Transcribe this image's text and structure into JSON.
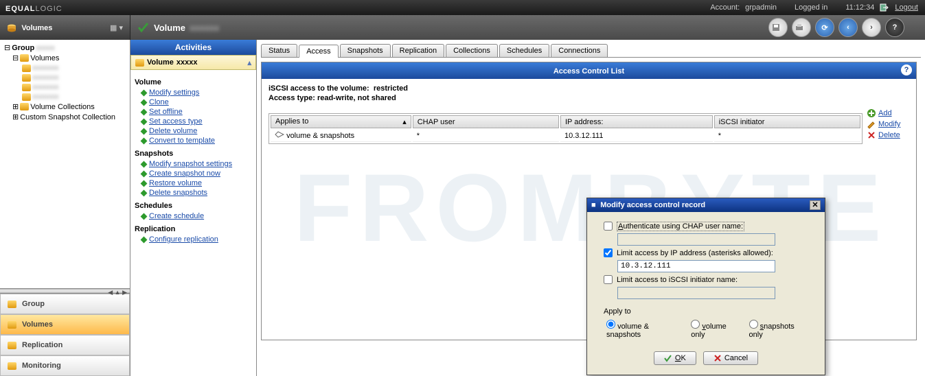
{
  "top": {
    "brand_prefix": "EQUAL",
    "brand_suffix": "LOGIC",
    "account_label": "Account:",
    "account_value": "grpadmin",
    "logged_in": "Logged in",
    "time": "11:12:34",
    "logout": "Logout"
  },
  "left_header": {
    "title": "Volumes"
  },
  "main_header": {
    "title": "Volume"
  },
  "tree": {
    "root": "Group",
    "volumes": "Volumes",
    "col": "Volume Collections",
    "snap": "Custom Snapshot Collection"
  },
  "bottom_nav": {
    "group": "Group",
    "volumes": "Volumes",
    "replication": "Replication",
    "monitoring": "Monitoring"
  },
  "activities": {
    "header": "Activities",
    "sub": "Volume",
    "groups": {
      "volume": {
        "title": "Volume",
        "links": [
          "Modify settings",
          "Clone",
          "Set offline",
          "Set access type",
          "Delete volume",
          "Convert to template"
        ]
      },
      "snapshots": {
        "title": "Snapshots",
        "links": [
          "Modify snapshot settings",
          "Create snapshot now",
          "Restore volume",
          "Delete snapshots"
        ]
      },
      "schedules": {
        "title": "Schedules",
        "links": [
          "Create schedule"
        ]
      },
      "replication": {
        "title": "Replication",
        "links": [
          "Configure replication"
        ]
      }
    }
  },
  "tabs": [
    "Status",
    "Access",
    "Snapshots",
    "Replication",
    "Collections",
    "Schedules",
    "Connections"
  ],
  "active_tab": "Access",
  "panel": {
    "title": "Access Control List",
    "line1_label": "iSCSI access to the volume:",
    "line1_value": "restricted",
    "line2_label": "Access type:",
    "line2_value": "read-write, not shared",
    "cols": {
      "applies": "Applies to",
      "chap": "CHAP user",
      "ip": "IP address:",
      "init": "iSCSI initiator"
    },
    "row": {
      "applies": "volume & snapshots",
      "chap": "*",
      "ip": "10.3.12.111",
      "init": "*"
    },
    "actions": {
      "add": "Add",
      "modify": "Modify",
      "delete": "Delete"
    }
  },
  "modal": {
    "title": "Modify access control record",
    "chap_label": "Authenticate using CHAP user name:",
    "ip_label": "Limit access by IP address (asterisks allowed):",
    "ip_value": "10.3.12.111",
    "init_label": "Limit access to iSCSI initiator name:",
    "apply_title": "Apply to",
    "r1": "volume & snapshots",
    "r2": "volume only",
    "r3": "snapshots only",
    "ok": "OK",
    "cancel": "Cancel"
  },
  "watermark": "FROMBYTE"
}
